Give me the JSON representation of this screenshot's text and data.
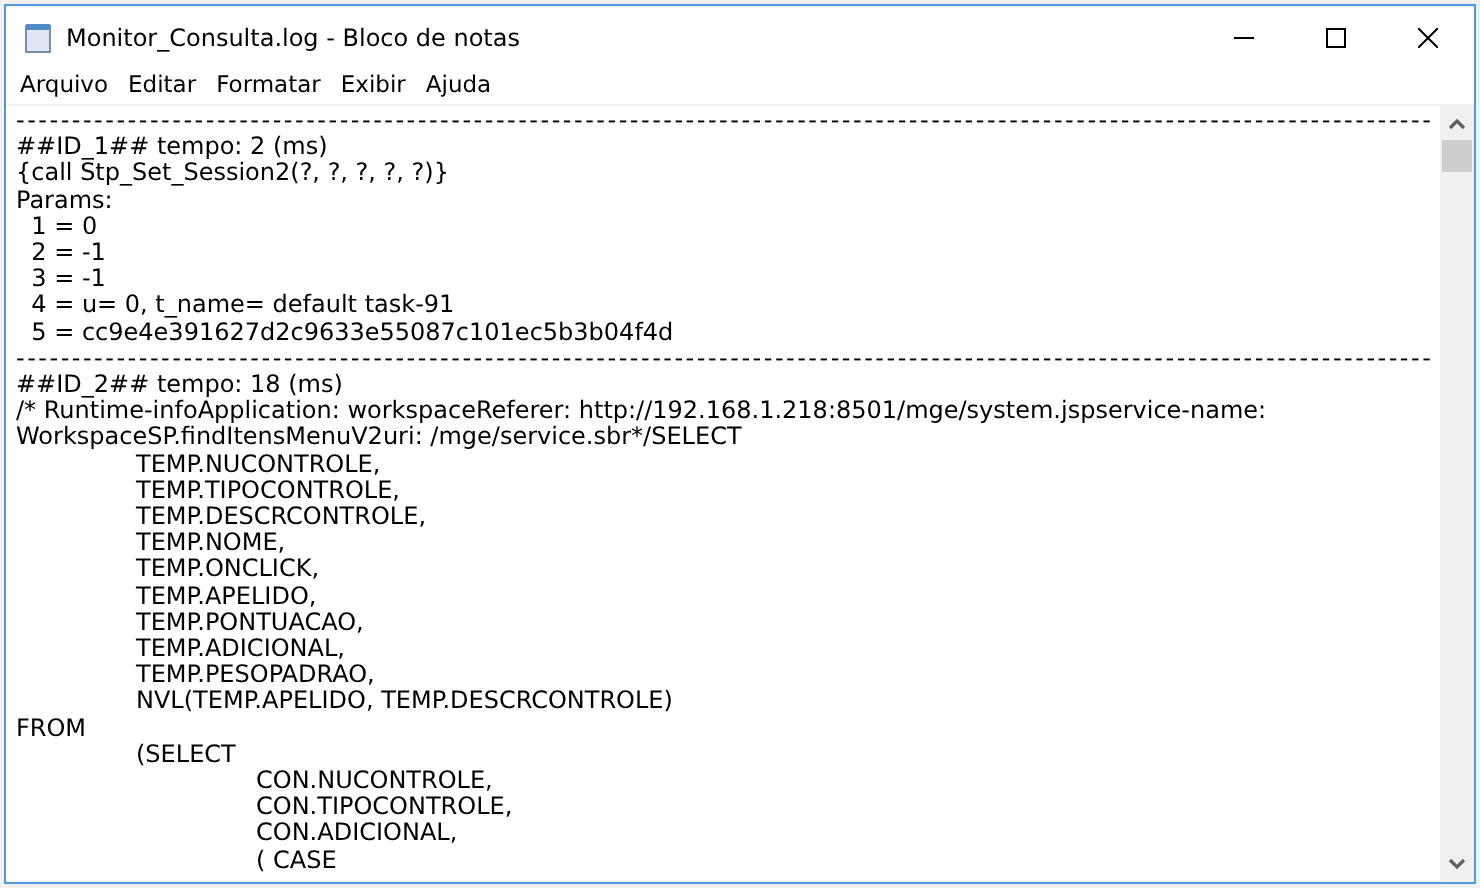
{
  "window": {
    "title": "Monitor_Consulta.log - Bloco de notas"
  },
  "menu": [
    "Arquivo",
    "Editar",
    "Formatar",
    "Exibir",
    "Ajuda"
  ],
  "lines": [
    {
      "kind": "separator",
      "text": "-------------------------------------------------------------------------------------------------------------------------------"
    },
    {
      "kind": "text",
      "text": "##ID_1## tempo: 2 (ms)"
    },
    {
      "kind": "text",
      "text": "{call Stp_Set_Session2(?, ?, ?, ?, ?)}"
    },
    {
      "kind": "text",
      "text": "Params:"
    },
    {
      "kind": "text",
      "text": "  1 = 0"
    },
    {
      "kind": "text",
      "text": "  2 = -1"
    },
    {
      "kind": "text",
      "text": "  3 = -1"
    },
    {
      "kind": "text",
      "text": "  4 = u= 0, t_name= default task-91"
    },
    {
      "kind": "text",
      "text": "  5 = cc9e4e391627d2c9633e55087c101ec5b3b04f4d"
    },
    {
      "kind": "separator",
      "text": "-------------------------------------------------------------------------------------------------------------------------------"
    },
    {
      "kind": "text",
      "text": "##ID_2## tempo: 18 (ms)"
    },
    {
      "kind": "text",
      "text": "/* Runtime-infoApplication: workspaceReferer: http://192.168.1.218:8501/mge/system.jspservice-name:"
    },
    {
      "kind": "text",
      "text": "WorkspaceSP.findItensMenuV2uri: /mge/service.sbr*/SELECT"
    },
    {
      "kind": "text",
      "text": "\tTEMP.NUCONTROLE,"
    },
    {
      "kind": "text",
      "text": "\tTEMP.TIPOCONTROLE,"
    },
    {
      "kind": "text",
      "text": "\tTEMP.DESCRCONTROLE,"
    },
    {
      "kind": "text",
      "text": "\tTEMP.NOME,"
    },
    {
      "kind": "text",
      "text": "\tTEMP.ONCLICK,"
    },
    {
      "kind": "text",
      "text": "\tTEMP.APELIDO,"
    },
    {
      "kind": "text",
      "text": "\tTEMP.PONTUACAO,"
    },
    {
      "kind": "text",
      "text": "\tTEMP.ADICIONAL,"
    },
    {
      "kind": "text",
      "text": "\tTEMP.PESOPADRAO,"
    },
    {
      "kind": "text",
      "text": "\tNVL(TEMP.APELIDO, TEMP.DESCRCONTROLE)"
    },
    {
      "kind": "text",
      "text": "FROM"
    },
    {
      "kind": "text",
      "text": "\t(SELECT"
    },
    {
      "kind": "text",
      "text": "\t\tCON.NUCONTROLE,"
    },
    {
      "kind": "text",
      "text": "\t\tCON.TIPOCONTROLE,"
    },
    {
      "kind": "text",
      "text": "\t\tCON.ADICIONAL,"
    },
    {
      "kind": "text",
      "text": "\t\t( CASE"
    }
  ]
}
